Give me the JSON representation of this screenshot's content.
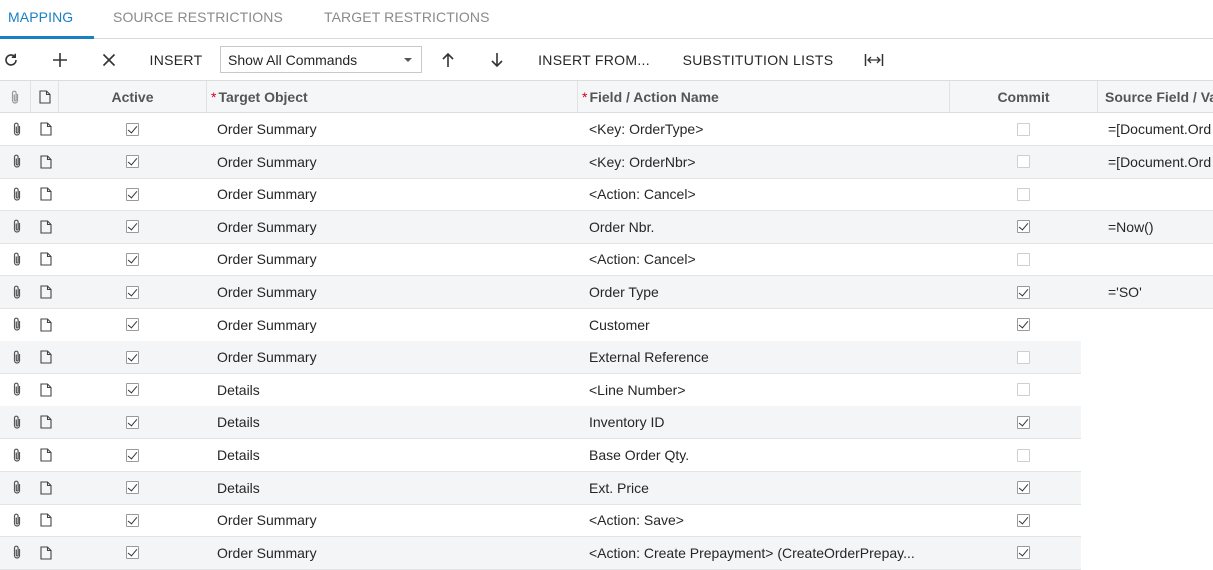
{
  "tabs": [
    {
      "label": "MAPPING",
      "active": true
    },
    {
      "label": "SOURCE RESTRICTIONS",
      "active": false
    },
    {
      "label": "TARGET RESTRICTIONS",
      "active": false
    }
  ],
  "toolbar": {
    "refresh_icon": "refresh-icon",
    "add_icon": "plus-icon",
    "delete_icon": "close-icon",
    "insert_label": "INSERT",
    "commands_select_value": "Show All Commands",
    "move_up_icon": "arrow-up-icon",
    "move_down_icon": "arrow-down-icon",
    "insert_from_label": "INSERT FROM...",
    "substitution_lists_label": "SUBSTITUTION LISTS",
    "fit_columns_icon": "fit-to-width-icon"
  },
  "columns": {
    "attach_icon": "paperclip-icon",
    "note_icon": "note-icon",
    "active": "Active",
    "target_object": "Target Object",
    "field_action_name": "Field / Action Name",
    "commit": "Commit",
    "source_field": "Source Field / Val"
  },
  "rows": [
    {
      "active": true,
      "target_object": "Order Summary",
      "field": "<Key: OrderType>",
      "commit": false,
      "source": "=[Document.Ord"
    },
    {
      "active": true,
      "target_object": "Order Summary",
      "field": "<Key: OrderNbr>",
      "commit": false,
      "source": "=[Document.Ord"
    },
    {
      "active": true,
      "target_object": "Order Summary",
      "field": "<Action: Cancel>",
      "commit": false,
      "source": ""
    },
    {
      "active": true,
      "target_object": "Order Summary",
      "field": "Order Nbr.",
      "commit": true,
      "source": "=Now()"
    },
    {
      "active": true,
      "target_object": "Order Summary",
      "field": "<Action: Cancel>",
      "commit": false,
      "source": ""
    },
    {
      "active": true,
      "target_object": "Order Summary",
      "field": "Order Type",
      "commit": true,
      "source": "='SO'"
    },
    {
      "active": true,
      "target_object": "Order Summary",
      "field": "Customer",
      "commit": true,
      "source": ""
    },
    {
      "active": true,
      "target_object": "Order Summary",
      "field": "External Reference",
      "commit": false,
      "source": ""
    },
    {
      "active": true,
      "target_object": "Details",
      "field": "<Line Number>",
      "commit": false,
      "source": ""
    },
    {
      "active": true,
      "target_object": "Details",
      "field": "Inventory ID",
      "commit": true,
      "source": ""
    },
    {
      "active": true,
      "target_object": "Details",
      "field": "Base Order Qty.",
      "commit": false,
      "source": ""
    },
    {
      "active": true,
      "target_object": "Details",
      "field": "Ext. Price",
      "commit": true,
      "source": ""
    },
    {
      "active": true,
      "target_object": "Order Summary",
      "field": "<Action: Save>",
      "commit": true,
      "source": ""
    },
    {
      "active": true,
      "target_object": "Order Summary",
      "field": "<Action: Create Prepayment> (CreateOrderPrepay...",
      "commit": true,
      "source": ""
    }
  ]
}
